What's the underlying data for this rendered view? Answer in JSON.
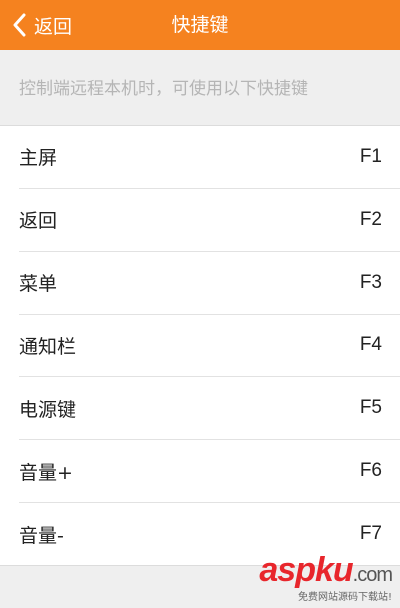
{
  "header": {
    "back_label": "返回",
    "title": "快捷键",
    "background_color": "#f5821f"
  },
  "hint": {
    "text": "控制端远程本机时，可使用以下快捷键"
  },
  "shortcuts": [
    {
      "label": "主屏",
      "key": "F1"
    },
    {
      "label": "返回",
      "key": "F2"
    },
    {
      "label": "菜单",
      "key": "F3"
    },
    {
      "label": "通知栏",
      "key": "F4"
    },
    {
      "label": "电源键",
      "key": "F5"
    },
    {
      "label": "音量+",
      "key": "F6"
    },
    {
      "label": "音量-",
      "key": "F7"
    }
  ],
  "watermark": {
    "brand_asp": "asp",
    "brand_ku": "ku",
    "brand_com": ".com",
    "tagline": "免费网站源码下载站!"
  }
}
